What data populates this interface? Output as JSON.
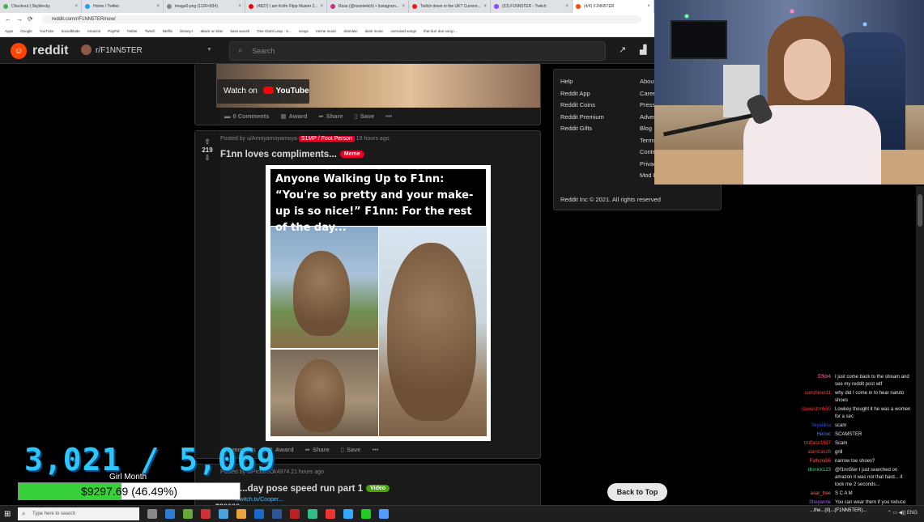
{
  "browser": {
    "tabs": [
      {
        "label": "Checkout | Skyblocky",
        "color": "#4caf50"
      },
      {
        "label": "Home / Twitter",
        "color": "#1da1f2"
      },
      {
        "label": "image0.png (1126×834)",
        "color": "#888888"
      },
      {
        "label": "(4837) I am Knife Flipp Master 2...",
        "color": "#ff0000"
      },
      {
        "label": "Rose (@rosetwitch) • Instagram...",
        "color": "#c13584"
      },
      {
        "label": "Twitch down in the UK? Current...",
        "color": "#e91e1e"
      },
      {
        "label": "(22) F1NN5TER - Twitch",
        "color": "#9146ff"
      },
      {
        "label": "(4/4) F1NN5TER",
        "color": "#ff4500"
      }
    ],
    "url": "reddit.com/r/F1NN5TER/new/",
    "bookmarks": [
      "Apps",
      "Google",
      "YouTube",
      "Socialblade",
      "Amazon",
      "PayPal",
      "Twitter",
      "Twitch",
      "Netflix",
      "Disney+",
      "attack on titan",
      "bass woosh",
      "One Giant Leap - S...",
      "songs",
      "meme music",
      "dramatic",
      "dank music",
      "overused songs",
      "that dun dun song i..."
    ]
  },
  "reddit": {
    "brand": "reddit",
    "subreddit": "r/F1NN5TER",
    "search_placeholder": "Search",
    "brand_color": "#ff4500"
  },
  "post_top": {
    "watch_on": "Watch on",
    "youtube": "YouTube",
    "comments": "0 Comments",
    "award": "Award",
    "share": "Share",
    "save": "Save",
    "more": "•••"
  },
  "post_main": {
    "posted_by": "Posted by u/Amoyamoyamoya",
    "flair": "S1MP / Foot Person",
    "time": "19 hours ago",
    "votes": "219",
    "title": "F1nn loves compliments...",
    "tag": "Meme",
    "meme_caption": "Anyone Walking Up to F1nn: “You're so pretty and your make-up is so nice!” F1nn: For the rest of the day...",
    "comments": "Comments",
    "award": "Award",
    "share": "Share",
    "save": "Save",
    "more": "•••"
  },
  "post_next": {
    "posted_by": "Posted by u/PictureOk4974",
    "time": "21 hours ago",
    "title": "...day pose speed run part 1",
    "tag": "Video",
    "link": "...witch.tv/Cooper..."
  },
  "sidebar": {
    "col1": [
      "Help",
      "Reddit App",
      "Reddit Coins",
      "Reddit Premium",
      "Reddit Gifts"
    ],
    "col2": [
      "About",
      "Careers",
      "Press",
      "Advertise",
      "Blog",
      "Terms",
      "Content Policy",
      "Privacy Policy",
      "Mod Policy"
    ],
    "copyright": "Reddit Inc © 2021. All rights reserved"
  },
  "back_to_top": "Back to Top",
  "stream": {
    "sub_count": "3,021 / 5,069",
    "goal_label": "Girl Month",
    "goal_text": "$9297.69 (46.49%)",
    "goal_fraction": 0.4649,
    "goal_small": "$20000",
    "ticker": "...the...(it)...(F1NN5TER)..."
  },
  "chat": [
    {
      "user": "Effdr4",
      "color": "#ff6b9d",
      "msg": "I just come back to the stream and\nsee my reddit post wtf"
    },
    {
      "user": "sunshiner11",
      "color": "#ff4040",
      "msg": "why did I come in to hear naruto\nshoes"
    },
    {
      "user": "daviestrinh50",
      "color": "#ff3030",
      "msg": "Lowkey thought it he was a women\nfor a sec"
    },
    {
      "user": "Yeyeiikra",
      "color": "#3050ff",
      "msg": "scam"
    },
    {
      "user": "Heroic",
      "color": "#4080ff",
      "msg": "SCAMSTER"
    },
    {
      "user": "trolface1997",
      "color": "#ff4040",
      "msg": "Scam"
    },
    {
      "user": "alanlzak28",
      "color": "#e04040",
      "msg": "grill"
    },
    {
      "user": "Falhoni56",
      "color": "#ff5050",
      "msg": "narrow toe shoes?"
    },
    {
      "user": "dlsnick123",
      "color": "#30e070",
      "msg": "@f1nn5ter I just searched on\namazon it was not that hard... it\ntook me 2 seconds..."
    },
    {
      "user": "asar_tree",
      "color": "#ff6060",
      "msg": "S C A M"
    },
    {
      "user": "Sheyanne",
      "color": "#a060ff",
      "msg": "You can wear them if you reduce"
    }
  ],
  "taskbar": {
    "search_placeholder": "Type here to search"
  }
}
